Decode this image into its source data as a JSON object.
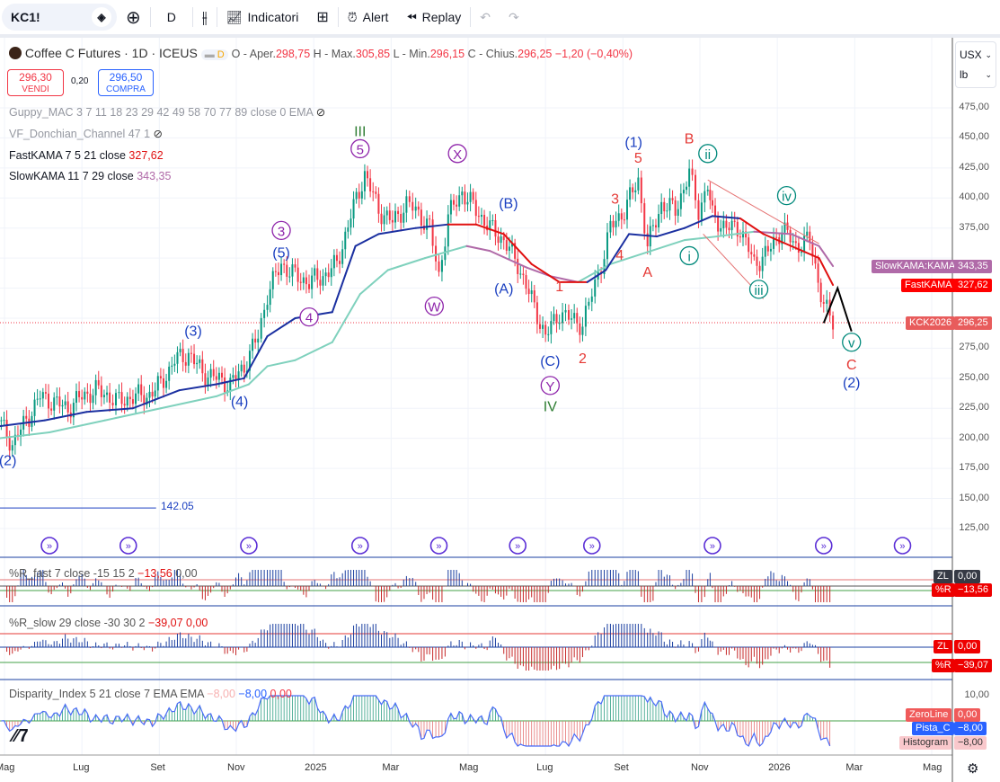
{
  "toolbar": {
    "symbol": "KC1!",
    "interval": "D",
    "indicators": "Indicatori",
    "alert": "Alert",
    "replay": "Replay"
  },
  "header": {
    "title": "Coffee C Futures · 1D · ICEUS",
    "badge": "D",
    "o_label": "O - Aper.",
    "o": "298,75",
    "h_label": "H - Max.",
    "h": "305,85",
    "l_label": "L - Min.",
    "l": "296,15",
    "c_label": "C - Chius.",
    "c": "296,25",
    "chg": "−1,20 (−0,40%)"
  },
  "trade": {
    "sell_price": "296,30",
    "sell_label": "VENDI",
    "spread": "0,20",
    "buy_price": "296,50",
    "buy_label": "COMPRA"
  },
  "studies": {
    "guppy": "Guppy_MAC 3 7 11 18 23 29 42 49 58 70 77 89 close 0 EMA",
    "donchian": "VF_Donchian_Channel 47 1",
    "fastkama": "FastKAMA 7 5 21 close",
    "fastkama_val": "327,62",
    "slowkama": "SlowKAMA 11 7 29 close",
    "slowkama_val": "343,35"
  },
  "pane_fast": {
    "title": "%R_fast 7 close -15 15 2",
    "v1": "−13,56",
    "v2": "0,00",
    "zl_label": "ZL",
    "zl": "0,00",
    "r_label": "%R",
    "r": "−13,56"
  },
  "pane_slow": {
    "title": "%R_slow 29 close -30 30 2",
    "v1": "−39,07",
    "v2": "0,00",
    "zl_label": "ZL",
    "zl": "0,00",
    "r_label": "%R",
    "r": "−39,07"
  },
  "pane_disp": {
    "title": "Disparity_Index 5 21 close 7 EMA EMA",
    "v1": "−8,00",
    "v2": "−8,00",
    "v3": "0,00",
    "axis": "10,00",
    "zero_label": "ZeroLine",
    "zero": "0,00",
    "pista_label": "Pista_C",
    "pista": "−8,00",
    "hist_label": "Histogram",
    "hist": "−8,00"
  },
  "axis_tags": {
    "slow_label": "SlowKAMA:KAMA",
    "slow": "343,35",
    "fast_label": "FastKAMA",
    "fast": "327,62",
    "sym_label": "KCK2026",
    "sym": "296,25"
  },
  "units": {
    "currency": "USX",
    "unit": "lb"
  },
  "level_label": "142.05",
  "colors": {
    "up": "#089981",
    "down": "#f23645",
    "fast_up": "#1a2fa0",
    "fast_dn": "#e01010",
    "slow_up": "#7fd1bd",
    "slow_dn": "#b06aa8"
  },
  "chart_data": {
    "type": "candlestick",
    "title": "Coffee C Futures · 1D · ICEUS",
    "ylim": [
      112,
      490
    ],
    "yticks": [
      125,
      150,
      175,
      200,
      225,
      250,
      275,
      300,
      325,
      350,
      375,
      400,
      425,
      450,
      475
    ],
    "ytick_labels": [
      "125,00",
      "150,00",
      "175,00",
      "200,00",
      "225,00",
      "250,00",
      "275,00",
      "",
      "",
      "",
      "375,00",
      "400,00",
      "425,00",
      "450,00",
      "475,00"
    ],
    "xticks": [
      {
        "t": 2024.333,
        "label": "Mag"
      },
      {
        "t": 2024.5,
        "label": "Lug"
      },
      {
        "t": 2024.667,
        "label": "Set"
      },
      {
        "t": 2024.833,
        "label": "Nov"
      },
      {
        "t": 2025.0,
        "label": "2025"
      },
      {
        "t": 2025.167,
        "label": "Mar"
      },
      {
        "t": 2025.333,
        "label": "Mag"
      },
      {
        "t": 2025.5,
        "label": "Lug"
      },
      {
        "t": 2025.667,
        "label": "Set"
      },
      {
        "t": 2025.833,
        "label": "Nov"
      },
      {
        "t": 2026.0,
        "label": "2026"
      },
      {
        "t": 2026.167,
        "label": "Mar"
      },
      {
        "t": 2026.333,
        "label": "Mag"
      }
    ],
    "close": [
      [
        2024.32,
        215
      ],
      [
        2024.35,
        195
      ],
      [
        2024.38,
        215
      ],
      [
        2024.41,
        235
      ],
      [
        2024.44,
        230
      ],
      [
        2024.47,
        225
      ],
      [
        2024.5,
        235
      ],
      [
        2024.53,
        240
      ],
      [
        2024.56,
        235
      ],
      [
        2024.58,
        230
      ],
      [
        2024.61,
        235
      ],
      [
        2024.64,
        235
      ],
      [
        2024.67,
        245
      ],
      [
        2024.7,
        265
      ],
      [
        2024.73,
        270
      ],
      [
        2024.76,
        255
      ],
      [
        2024.79,
        250
      ],
      [
        2024.82,
        245
      ],
      [
        2024.85,
        260
      ],
      [
        2024.88,
        285
      ],
      [
        2024.9,
        320
      ],
      [
        2024.93,
        345
      ],
      [
        2024.96,
        335
      ],
      [
        2024.99,
        330
      ],
      [
        2025.02,
        335
      ],
      [
        2025.05,
        345
      ],
      [
        2025.08,
        385
      ],
      [
        2025.11,
        420
      ],
      [
        2025.14,
        390
      ],
      [
        2025.17,
        380
      ],
      [
        2025.2,
        395
      ],
      [
        2025.22,
        390
      ],
      [
        2025.25,
        375
      ],
      [
        2025.27,
        335
      ],
      [
        2025.29,
        385
      ],
      [
        2025.32,
        405
      ],
      [
        2025.35,
        390
      ],
      [
        2025.38,
        375
      ],
      [
        2025.41,
        365
      ],
      [
        2025.44,
        345
      ],
      [
        2025.47,
        315
      ],
      [
        2025.5,
        285
      ],
      [
        2025.53,
        305
      ],
      [
        2025.55,
        300
      ],
      [
        2025.58,
        295
      ],
      [
        2025.6,
        320
      ],
      [
        2025.62,
        345
      ],
      [
        2025.64,
        375
      ],
      [
        2025.67,
        390
      ],
      [
        2025.7,
        415
      ],
      [
        2025.72,
        360
      ],
      [
        2025.75,
        395
      ],
      [
        2025.78,
        390
      ],
      [
        2025.81,
        420
      ],
      [
        2025.83,
        390
      ],
      [
        2025.85,
        410
      ],
      [
        2025.86,
        385
      ],
      [
        2025.89,
        375
      ],
      [
        2025.92,
        375
      ],
      [
        2025.95,
        345
      ],
      [
        2025.98,
        355
      ],
      [
        2026.01,
        375
      ],
      [
        2026.04,
        360
      ],
      [
        2026.07,
        365
      ],
      [
        2026.1,
        310
      ],
      [
        2026.12,
        296.25
      ]
    ],
    "fast_kama": [
      [
        2024.32,
        210,
        1
      ],
      [
        2024.42,
        215,
        1
      ],
      [
        2024.51,
        222,
        1
      ],
      [
        2024.61,
        225,
        1
      ],
      [
        2024.71,
        240,
        1
      ],
      [
        2024.79,
        245,
        1
      ],
      [
        2024.85,
        250,
        1
      ],
      [
        2024.9,
        285,
        1
      ],
      [
        2024.96,
        300,
        1
      ],
      [
        2025.04,
        305,
        1
      ],
      [
        2025.09,
        360,
        1
      ],
      [
        2025.14,
        370,
        1
      ],
      [
        2025.22,
        375,
        1
      ],
      [
        2025.29,
        378,
        1
      ],
      [
        2025.35,
        378,
        0
      ],
      [
        2025.41,
        370,
        0
      ],
      [
        2025.47,
        345,
        0
      ],
      [
        2025.53,
        330,
        0
      ],
      [
        2025.59,
        330,
        0
      ],
      [
        2025.63,
        340,
        1
      ],
      [
        2025.68,
        370,
        1
      ],
      [
        2025.74,
        368,
        1
      ],
      [
        2025.8,
        375,
        1
      ],
      [
        2025.86,
        385,
        1
      ],
      [
        2025.92,
        383,
        1
      ],
      [
        2025.97,
        370,
        0
      ],
      [
        2026.03,
        360,
        0
      ],
      [
        2026.09,
        350,
        0
      ],
      [
        2026.12,
        327.62,
        0
      ]
    ],
    "slow_kama": [
      [
        2024.32,
        200,
        1
      ],
      [
        2024.43,
        205,
        1
      ],
      [
        2024.55,
        215,
        1
      ],
      [
        2024.67,
        225,
        1
      ],
      [
        2024.79,
        235,
        1
      ],
      [
        2024.86,
        245,
        1
      ],
      [
        2024.9,
        260,
        1
      ],
      [
        2024.96,
        265,
        1
      ],
      [
        2025.04,
        280,
        1
      ],
      [
        2025.1,
        320,
        1
      ],
      [
        2025.16,
        340,
        1
      ],
      [
        2025.24,
        350,
        1
      ],
      [
        2025.33,
        360,
        1
      ],
      [
        2025.38,
        356,
        0
      ],
      [
        2025.46,
        342,
        0
      ],
      [
        2025.51,
        335,
        0
      ],
      [
        2025.57,
        330,
        0
      ],
      [
        2025.64,
        345,
        1
      ],
      [
        2025.72,
        355,
        1
      ],
      [
        2025.8,
        365,
        1
      ],
      [
        2025.87,
        368,
        1
      ],
      [
        2025.95,
        372,
        1
      ],
      [
        2026.03,
        370,
        0
      ],
      [
        2026.09,
        360,
        0
      ],
      [
        2026.12,
        343.35,
        0
      ]
    ],
    "projection": [
      [
        2026.1,
        296
      ],
      [
        2026.13,
        325
      ],
      [
        2026.16,
        289
      ]
    ],
    "trendlines": [
      [
        [
          2025.85,
          415
        ],
        [
          2026.09,
          362
        ]
      ],
      [
        [
          2025.84,
          370
        ],
        [
          2025.97,
          316
        ]
      ]
    ],
    "level": {
      "value": 142.05,
      "from": 2024.32,
      "to": 2024.66
    },
    "wave_labels": [
      {
        "text": "(2)",
        "t": 2024.34,
        "p": 182,
        "color": "#1a3fc0",
        "circle": false
      },
      {
        "text": "(3)",
        "t": 2024.74,
        "p": 290,
        "color": "#1a3fc0",
        "circle": false
      },
      {
        "text": "(4)",
        "t": 2024.84,
        "p": 231,
        "color": "#1a3fc0",
        "circle": false
      },
      {
        "text": "3",
        "t": 2024.93,
        "p": 373,
        "color": "#8e24aa",
        "circle": true
      },
      {
        "text": "(5)",
        "t": 2024.93,
        "p": 355,
        "color": "#1a3fc0",
        "circle": false
      },
      {
        "text": "4",
        "t": 2024.99,
        "p": 301,
        "color": "#8e24aa",
        "circle": true
      },
      {
        "text": "III",
        "t": 2025.1,
        "p": 456,
        "color": "#2e7d32",
        "circle": false
      },
      {
        "text": "5",
        "t": 2025.1,
        "p": 441,
        "color": "#8e24aa",
        "circle": true
      },
      {
        "text": "X",
        "t": 2025.31,
        "p": 437,
        "color": "#8e24aa",
        "circle": true
      },
      {
        "text": "W",
        "t": 2025.26,
        "p": 310,
        "color": "#8e24aa",
        "circle": true
      },
      {
        "text": "(B)",
        "t": 2025.42,
        "p": 396,
        "color": "#1a3fc0",
        "circle": false
      },
      {
        "text": "(A)",
        "t": 2025.41,
        "p": 325,
        "color": "#1a3fc0",
        "circle": false
      },
      {
        "text": "1",
        "t": 2025.53,
        "p": 327,
        "color": "#e53935",
        "circle": false
      },
      {
        "text": "(C)",
        "t": 2025.51,
        "p": 265,
        "color": "#1a3fc0",
        "circle": false
      },
      {
        "text": "Y",
        "t": 2025.51,
        "p": 244,
        "color": "#8e24aa",
        "circle": true
      },
      {
        "text": "IV",
        "t": 2025.51,
        "p": 227,
        "color": "#2e7d32",
        "circle": false
      },
      {
        "text": "2",
        "t": 2025.58,
        "p": 267,
        "color": "#e53935",
        "circle": false
      },
      {
        "text": "3",
        "t": 2025.65,
        "p": 400,
        "color": "#e53935",
        "circle": false
      },
      {
        "text": "4",
        "t": 2025.66,
        "p": 353,
        "color": "#e53935",
        "circle": false
      },
      {
        "text": "(1)",
        "t": 2025.69,
        "p": 447,
        "color": "#1a3fc0",
        "circle": false
      },
      {
        "text": "5",
        "t": 2025.7,
        "p": 434,
        "color": "#e53935",
        "circle": false
      },
      {
        "text": "A",
        "t": 2025.72,
        "p": 339,
        "color": "#e53935",
        "circle": false
      },
      {
        "text": "B",
        "t": 2025.81,
        "p": 450,
        "color": "#e53935",
        "circle": false
      },
      {
        "text": "ii",
        "t": 2025.85,
        "p": 437,
        "color": "#00897b",
        "circle": true
      },
      {
        "text": "i",
        "t": 2025.81,
        "p": 352,
        "color": "#00897b",
        "circle": true
      },
      {
        "text": "iii",
        "t": 2025.96,
        "p": 324,
        "color": "#00897b",
        "circle": true
      },
      {
        "text": "iv",
        "t": 2026.02,
        "p": 402,
        "color": "#00897b",
        "circle": true
      },
      {
        "text": "v",
        "t": 2026.16,
        "p": 280,
        "color": "#00897b",
        "circle": true
      },
      {
        "text": "C",
        "t": 2026.16,
        "p": 262,
        "color": "#e53935",
        "circle": false
      },
      {
        "text": "(2)",
        "t": 2026.16,
        "p": 247,
        "color": "#1a3fc0",
        "circle": false
      }
    ],
    "events": [
      2024.43,
      2024.6,
      2024.86,
      2025.1,
      2025.27,
      2025.44,
      2025.6,
      2025.86,
      2026.1,
      2026.27
    ]
  }
}
